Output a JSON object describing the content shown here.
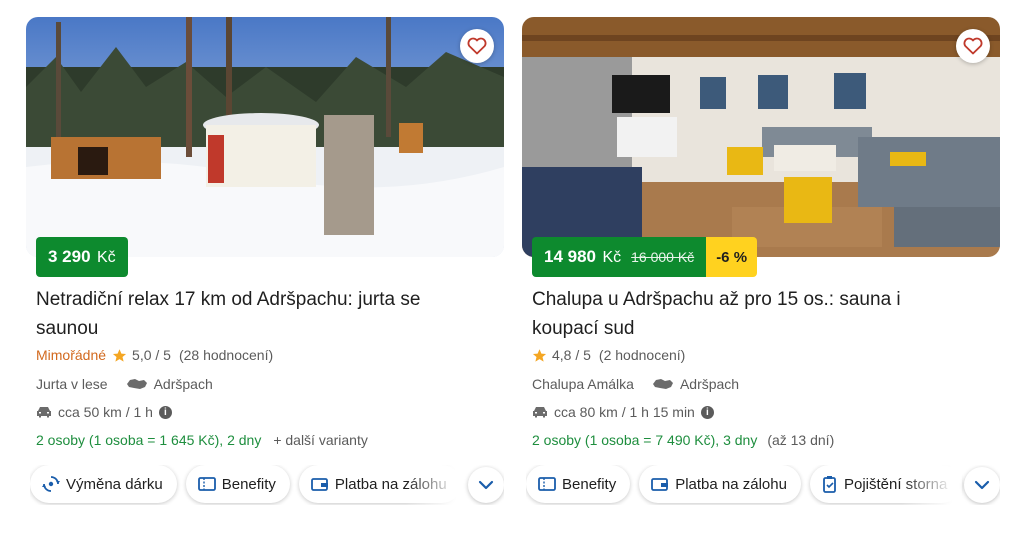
{
  "colors": {
    "price_green": "#0d8a2e",
    "discount_yellow": "#ffd21f",
    "rating_orange": "#d2691e",
    "star": "#f4a623",
    "link_blue": "#1a5dab",
    "variant_green": "#1e8e3e"
  },
  "cards": [
    {
      "image": "yurt-in-snowy-forest",
      "price": "3 290",
      "currency": "Kč",
      "title": "Netradiční relax 17 km od Adršpachu: jurta se saunou",
      "rating_badge": "Mimořádné",
      "rating": "5,0 / 5",
      "reviews": "(28 hodnocení)",
      "property": "Jurta v lese",
      "location": "Adršpach",
      "distance": "cca 50 km / 1 h",
      "persons": "2 osoby (1 osoba = 1 645 Kč), 2 dny",
      "extra": "+  další varianty",
      "chips": [
        {
          "icon": "exchange-icon",
          "label": "Výměna dárku"
        },
        {
          "icon": "ticket-icon",
          "label": "Benefity"
        },
        {
          "icon": "wallet-icon",
          "label": "Platba na zálohu"
        }
      ]
    },
    {
      "image": "cottage-living-room",
      "price": "14 980",
      "currency": "Kč",
      "old_price": "16 000 Kč",
      "discount": "-6 %",
      "title": "Chalupa u Adršpachu až pro 15 os.: sauna i koupací sud",
      "rating": "4,8 / 5",
      "reviews": "(2 hodnocení)",
      "property": "Chalupa Amálka",
      "location": "Adršpach",
      "distance": "cca 80 km / 1 h 15 min",
      "persons": "2 osoby (1 osoba = 7 490 Kč), 3 dny",
      "extra": "(až 13 dní)",
      "chips": [
        {
          "icon": "ticket-icon",
          "label": "Benefity"
        },
        {
          "icon": "wallet-icon",
          "label": "Platba na zálohu"
        },
        {
          "icon": "insurance-icon",
          "label": "Pojištění storna"
        }
      ]
    }
  ]
}
